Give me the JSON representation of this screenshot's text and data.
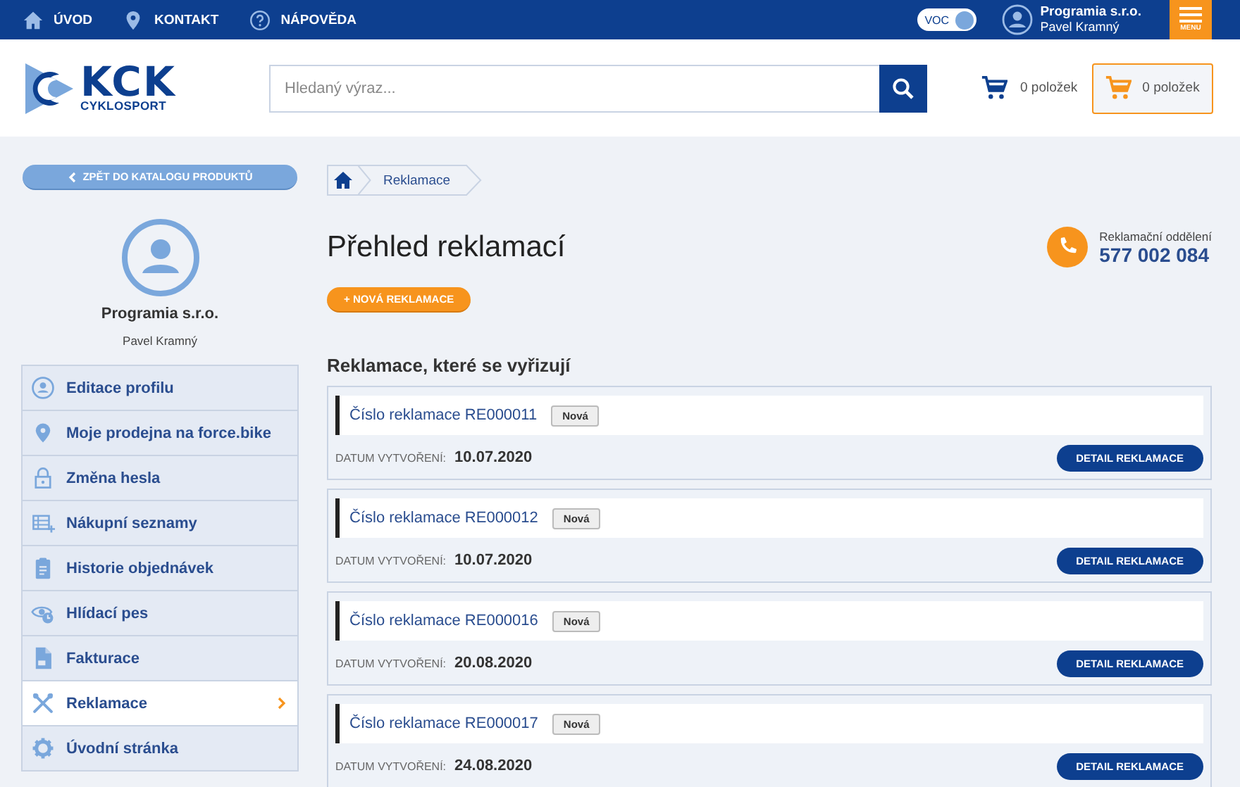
{
  "top_bar": {
    "links": [
      "ÚVOD",
      "KONTAKT",
      "NÁPOVĚDA"
    ],
    "voc_toggle": {
      "label": "VOC",
      "on": true
    },
    "user": {
      "company": "Programia s.r.o.",
      "name": "Pavel Kramný"
    },
    "menu_button": "MENU"
  },
  "header": {
    "logo": {
      "title": "KCK",
      "subtitle": "CYKLOSPORT"
    },
    "search": {
      "placeholder": "Hledaný výraz..."
    },
    "cart_summary": "0 položek",
    "cart_button": "0 položek"
  },
  "sidebar": {
    "back_button": "ZPĚT DO KATALOGU PRODUKTŮ",
    "profile": {
      "company": "Programia s.r.o.",
      "name": "Pavel Kramný"
    },
    "items": [
      {
        "label": "Editace profilu",
        "selected": false
      },
      {
        "label": "Moje prodejna na force.bike",
        "selected": false
      },
      {
        "label": "Změna hesla",
        "selected": false
      },
      {
        "label": "Nákupní seznamy",
        "selected": false
      },
      {
        "label": "Historie objednávek",
        "selected": false
      },
      {
        "label": "Hlídací pes",
        "selected": false
      },
      {
        "label": "Fakturace",
        "selected": false
      },
      {
        "label": "Reklamace",
        "selected": true
      },
      {
        "label": "Úvodní stránka",
        "selected": false
      }
    ]
  },
  "breadcrumb": [
    "Reklamace"
  ],
  "title": "Přehled reklamací",
  "contact": {
    "label": "Reklamační oddělení",
    "phone": "577 002 084"
  },
  "new_button": "+ NOVÁ REKLAMACE",
  "section_title": "Reklamace, které se vyřizují",
  "claims": [
    {
      "title": "Číslo reklamace RE000011",
      "status": "Nová",
      "date_label": "DATUM VYTVOŘENÍ:",
      "date": "10.07.2020",
      "button": "DETAIL REKLAMACE"
    },
    {
      "title": "Číslo reklamace RE000012",
      "status": "Nová",
      "date_label": "DATUM VYTVOŘENÍ:",
      "date": "10.07.2020",
      "button": "DETAIL REKLAMACE"
    },
    {
      "title": "Číslo reklamace RE000016",
      "status": "Nová",
      "date_label": "DATUM VYTVOŘENÍ:",
      "date": "20.08.2020",
      "button": "DETAIL REKLAMACE"
    },
    {
      "title": "Číslo reklamace RE000017",
      "status": "Nová",
      "date_label": "DATUM VYTVOŘENÍ:",
      "date": "24.08.2020",
      "button": "DETAIL REKLAMACE"
    }
  ]
}
